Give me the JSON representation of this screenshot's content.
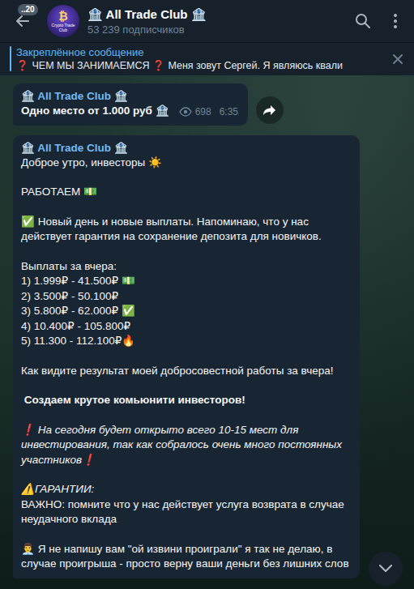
{
  "header": {
    "back_badge": "..20",
    "avatar_symbol": "₿",
    "avatar_text": "Crypto Trade Club",
    "title": "🏦 All Trade Club 🏦",
    "subtitle": "53 239 подписчиков"
  },
  "pinned": {
    "label": "Закреплённое сообщение",
    "text": "❓ ЧЕМ МЫ ЗАНИМАЕМСЯ ❓ Меня зовут Сергей.  Я являюсь квали"
  },
  "messages": [
    {
      "author": "🏦 All Trade Club 🏦",
      "forward_button": true,
      "views": "698",
      "time": "6:35",
      "blocks": [
        [
          {
            "text": "Одно место от 1.000 руб 🏦",
            "kind": "bold"
          }
        ]
      ]
    },
    {
      "author": "🏦 All Trade Club 🏦",
      "forward_button": false,
      "views": "",
      "time": "",
      "blocks": [
        [
          {
            "text": "Доброе утро, инвесторы ☀️",
            "kind": "plain"
          }
        ],
        [
          {
            "text": "РАБОТАЕМ 💵",
            "kind": "plain"
          }
        ],
        [
          {
            "text": "✅ Новый день и новые выплаты. Напоминаю, что у нас действует гарантия на сохранение депозита для новичков.",
            "kind": "plain"
          }
        ],
        [
          {
            "text": "Выплаты за вчера:",
            "kind": "plain"
          },
          {
            "text": "1) 1.999₽ - 41.500₽ 💵",
            "kind": "plain"
          },
          {
            "text": "2) 3.500₽ - 50.100₽",
            "kind": "plain"
          },
          {
            "text": "3) 5.800₽ - 62.000₽ ✅",
            "kind": "plain"
          },
          {
            "text": "4) 10.400₽ - 105.800₽",
            "kind": "plain"
          },
          {
            "text": "5) 11.300 - 112.100₽🔥",
            "kind": "plain"
          }
        ],
        [
          {
            "text": "Как видите результат моей добросовестной работы за вчера!",
            "kind": "plain"
          }
        ],
        [
          {
            "text": " Создаем крутое комьюнити инвесторов!",
            "kind": "bold"
          }
        ],
        [
          {
            "text": "❗ На сегодня будет открыто всего 10-15 мест для инвестирования, так как собралось очень много постоянных участников❗",
            "kind": "italic"
          }
        ],
        [
          {
            "text": "⚠️ГАРАНТИИ:",
            "kind": "italic"
          },
          {
            "text": "ВАЖНО: помните что у нас действует услуга возврата в случае неудачного вклада",
            "kind": "plain"
          }
        ],
        [
          {
            "text": "👨‍💼 Я не напишу вам \"ой извини проиграли\" я так не делаю, в случае проигрыша - просто верну ваши деньги без лишних слов",
            "kind": "plain"
          }
        ]
      ]
    }
  ]
}
